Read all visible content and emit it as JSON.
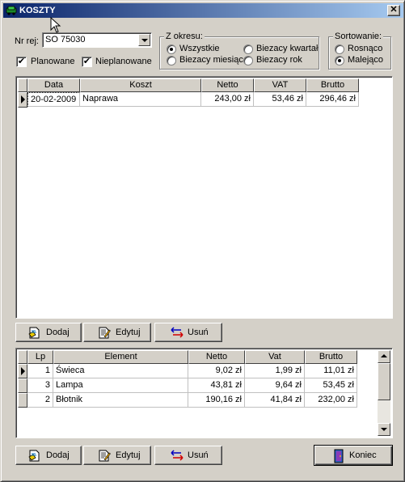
{
  "window": {
    "title": "KOSZTY",
    "close_glyph": "✕"
  },
  "filters": {
    "nr_rej_label": "Nr rej:",
    "nr_rej_value": "SO 75030",
    "planowane_label": "Planowane",
    "planowane_checked": true,
    "nieplanowane_label": "Nieplanowane",
    "nieplanowane_checked": true,
    "check_glyph": "✔"
  },
  "period": {
    "caption": "Z okresu:",
    "options": [
      "Wszystkie",
      "Biezacy kwartał",
      "Biezacy miesiąc",
      "Biezacy rok"
    ],
    "selected": "Wszystkie"
  },
  "sorting": {
    "caption": "Sortowanie:",
    "options": [
      "Rosnąco",
      "Malejąco"
    ],
    "selected": "Malejąco"
  },
  "costs_table": {
    "columns": [
      "Data",
      "Koszt",
      "Netto",
      "VAT",
      "Brutto"
    ],
    "rows": [
      {
        "data": "20-02-2009",
        "koszt": "Naprawa",
        "netto": "243,00 zł",
        "vat": "53,46 zł",
        "brutto": "296,46 zł"
      }
    ]
  },
  "costs_buttons": {
    "add": "Dodaj",
    "edit": "Edytuj",
    "delete": "Usuń"
  },
  "elements_table": {
    "columns": [
      "Lp",
      "Element",
      "Netto",
      "Vat",
      "Brutto"
    ],
    "rows": [
      {
        "lp": "1",
        "element": "Świeca",
        "netto": "9,02 zł",
        "vat": "1,99 zł",
        "brutto": "11,01 zł"
      },
      {
        "lp": "3",
        "element": "Lampa",
        "netto": "43,81 zł",
        "vat": "9,64 zł",
        "brutto": "53,45 zł"
      },
      {
        "lp": "2",
        "element": "Błotnik",
        "netto": "190,16 zł",
        "vat": "41,84 zł",
        "brutto": "232,00 zł"
      }
    ]
  },
  "elements_buttons": {
    "add": "Dodaj",
    "edit": "Edytuj",
    "delete": "Usuń"
  },
  "close_button": {
    "label": "Koniec"
  },
  "icons": {
    "app": "green-car-icon",
    "add": "add-document-icon",
    "edit": "edit-document-icon",
    "delete": "delete-arrows-icon",
    "close": "door-exit-icon"
  },
  "colors": {
    "title_start": "#0a246a",
    "title_end": "#a6caf0",
    "face": "#d4d0c8"
  }
}
